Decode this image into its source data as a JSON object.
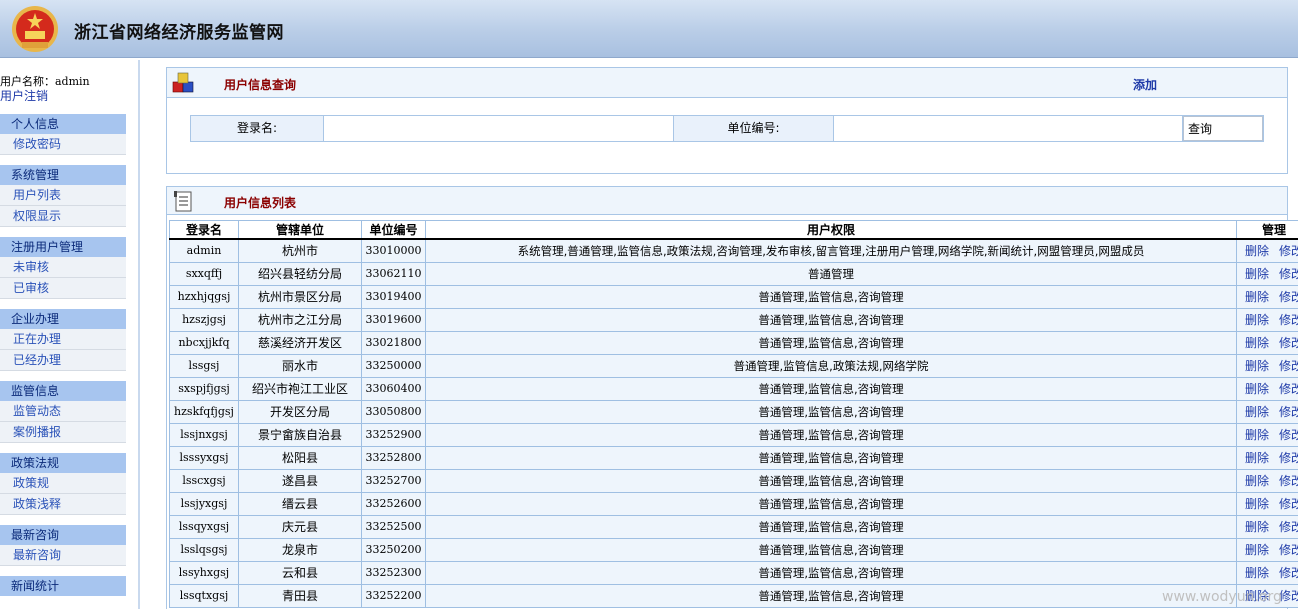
{
  "header": {
    "site_title": "浙江省网络经济服务监管网"
  },
  "user": {
    "name_label": "用户名称：",
    "name": "admin",
    "logout": "用户注销"
  },
  "sidebar": [
    {
      "head": "个人信息",
      "items": [
        "修改密码"
      ]
    },
    {
      "head": "系统管理",
      "items": [
        "用户列表",
        "权限显示"
      ]
    },
    {
      "head": "注册用户管理",
      "items": [
        "未审核",
        "已审核"
      ]
    },
    {
      "head": "企业办理",
      "items": [
        "正在办理",
        "已经办理"
      ]
    },
    {
      "head": "监管信息",
      "items": [
        "监管动态",
        "案例播报"
      ]
    },
    {
      "head": "政策法规",
      "items": [
        "政策规",
        "政策浅释"
      ]
    },
    {
      "head": "最新咨询",
      "items": [
        "最新咨询"
      ]
    },
    {
      "head": "新闻统计",
      "items": []
    }
  ],
  "query_panel": {
    "title": "用户信息查询",
    "add_label": "添加",
    "login_label": "登录名:",
    "login_value": "",
    "unit_code_label": "单位编号:",
    "unit_code_value": "",
    "query_button": "查询"
  },
  "list_panel": {
    "title": "用户信息列表",
    "columns": [
      "登录名",
      "管辖单位",
      "单位编号",
      "用户权限",
      "管理"
    ],
    "delete_label": "删除",
    "edit_label": "修改",
    "rows": [
      {
        "login": "admin",
        "unit": "杭州市",
        "code": "33010000",
        "perm": "系统管理,普通管理,监管信息,政策法规,咨询管理,发布审核,留言管理,注册用户管理,网络学院,新闻统计,网盟管理员,网盟成员"
      },
      {
        "login": "sxxqffj",
        "unit": "绍兴县轻纺分局",
        "code": "33062110",
        "perm": "普通管理"
      },
      {
        "login": "hzxhjqgsj",
        "unit": "杭州市景区分局",
        "code": "33019400",
        "perm": "普通管理,监管信息,咨询管理"
      },
      {
        "login": "hzszjgsj",
        "unit": "杭州市之江分局",
        "code": "33019600",
        "perm": "普通管理,监管信息,咨询管理"
      },
      {
        "login": "nbcxjjkfq",
        "unit": "慈溪经济开发区",
        "code": "33021800",
        "perm": "普通管理,监管信息,咨询管理"
      },
      {
        "login": "lssgsj",
        "unit": "丽水市",
        "code": "33250000",
        "perm": "普通管理,监管信息,政策法规,网络学院"
      },
      {
        "login": "sxspjfjgsj",
        "unit": "绍兴市袍江工业区",
        "code": "33060400",
        "perm": "普通管理,监管信息,咨询管理"
      },
      {
        "login": "hzskfqfjgsj",
        "unit": "开发区分局",
        "code": "33050800",
        "perm": "普通管理,监管信息,咨询管理"
      },
      {
        "login": "lssjnxgsj",
        "unit": "景宁畲族自治县",
        "code": "33252900",
        "perm": "普通管理,监管信息,咨询管理"
      },
      {
        "login": "lsssyxgsj",
        "unit": "松阳县",
        "code": "33252800",
        "perm": "普通管理,监管信息,咨询管理"
      },
      {
        "login": "lsscxgsj",
        "unit": "遂昌县",
        "code": "33252700",
        "perm": "普通管理,监管信息,咨询管理"
      },
      {
        "login": "lssjyxgsj",
        "unit": "缙云县",
        "code": "33252600",
        "perm": "普通管理,监管信息,咨询管理"
      },
      {
        "login": "lssqyxgsj",
        "unit": "庆元县",
        "code": "33252500",
        "perm": "普通管理,监管信息,咨询管理"
      },
      {
        "login": "lsslqsgsj",
        "unit": "龙泉市",
        "code": "33250200",
        "perm": "普通管理,监管信息,咨询管理"
      },
      {
        "login": "lssyhxgsj",
        "unit": "云和县",
        "code": "33252300",
        "perm": "普通管理,监管信息,咨询管理"
      },
      {
        "login": "lssqtxgsj",
        "unit": "青田县",
        "code": "33252200",
        "perm": "普通管理,监管信息,咨询管理"
      }
    ]
  },
  "watermark": "www.wodyun.org",
  "colors": {
    "header_bg": "#b9cde7",
    "menu_head": "#a7c5ef",
    "panel_title": "#8b0000",
    "link": "#1e3aa8"
  }
}
